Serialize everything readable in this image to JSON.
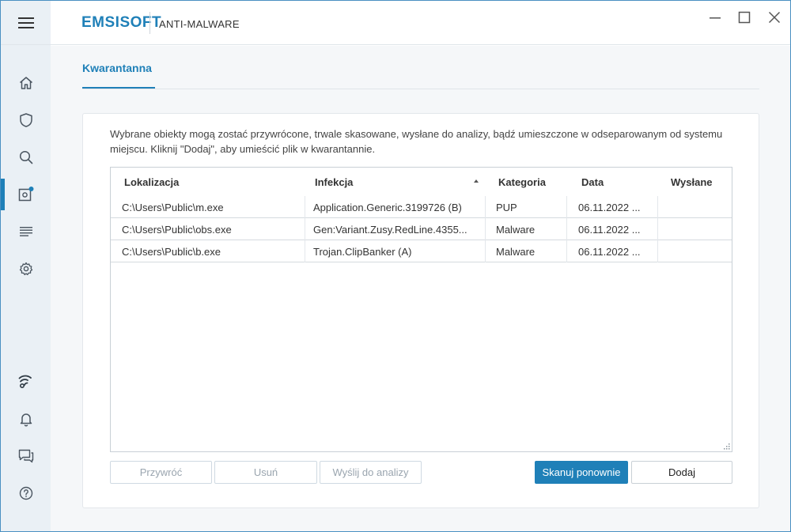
{
  "app": {
    "brand": "EMSISOFT",
    "product": "ANTI-MALWARE"
  },
  "sidebar": {
    "items": [
      {
        "icon": "home-icon"
      },
      {
        "icon": "shield-icon"
      },
      {
        "icon": "search-icon"
      },
      {
        "icon": "quarantine-icon",
        "active": true
      },
      {
        "icon": "logs-icon"
      },
      {
        "icon": "gear-icon"
      },
      {
        "icon": "wireless-icon"
      },
      {
        "icon": "bell-icon"
      },
      {
        "icon": "chat-icon"
      },
      {
        "icon": "help-icon"
      }
    ]
  },
  "page": {
    "tab": "Kwarantanna",
    "description": "Wybrane obiekty mogą zostać przywrócone, trwale skasowane, wysłane do analizy, bądź umieszczone w odseparowanym od systemu miejscu. Kliknij \"Dodaj\", aby umieścić plik w kwarantannie."
  },
  "table": {
    "columns": [
      "Lokalizacja",
      "Infekcja",
      "Kategoria",
      "Data",
      "Wysłane"
    ],
    "rows": [
      [
        "C:\\Users\\Public\\m.exe",
        "Application.Generic.3199726 (B)",
        "PUP",
        "06.11.2022 ...",
        ""
      ],
      [
        "C:\\Users\\Public\\obs.exe",
        "Gen:Variant.Zusy.RedLine.4355...",
        "Malware",
        "06.11.2022 ...",
        ""
      ],
      [
        "C:\\Users\\Public\\b.exe",
        "Trojan.ClipBanker (A)",
        "Malware",
        "06.11.2022 ...",
        ""
      ]
    ]
  },
  "buttons": {
    "restore": "Przywróć",
    "delete": "Usuń",
    "send": "Wyślij do analizy",
    "rescan": "Skanuj ponownie",
    "add": "Dodaj"
  },
  "colors": {
    "accent": "#1f80b8",
    "sidebar_bg": "#eaf0f5"
  }
}
